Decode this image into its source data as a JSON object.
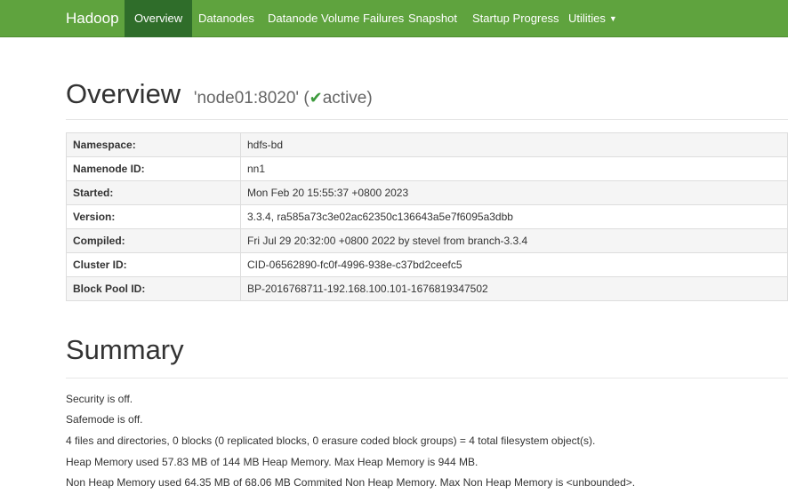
{
  "navbar": {
    "brand": "Hadoop",
    "items": [
      {
        "label": "Overview"
      },
      {
        "label": "Datanodes"
      },
      {
        "label": "Datanode Volume Failures"
      },
      {
        "label": "Snapshot"
      },
      {
        "label": "Startup Progress"
      },
      {
        "label": "Utilities"
      }
    ],
    "active_item": "Overview",
    "active_color": "#2f6d2a",
    "bar_color": "#5fa33e"
  },
  "overview": {
    "title": "Overview",
    "node": "'node01:8020'",
    "status_open": "(",
    "status_check_icon": "check-icon",
    "status": "active)",
    "status_color": "#3c9a3c"
  },
  "info_rows": [
    {
      "label": "Namespace:",
      "value": "hdfs-bd"
    },
    {
      "label": "Namenode ID:",
      "value": "nn1"
    },
    {
      "label": "Started:",
      "value": "Mon Feb 20 15:55:37 +0800 2023"
    },
    {
      "label": "Version:",
      "value": "3.3.4, ra585a73c3e02ac62350c136643a5e7f6095a3dbb"
    },
    {
      "label": "Compiled:",
      "value": "Fri Jul 29 20:32:00 +0800 2022 by stevel from branch-3.3.4"
    },
    {
      "label": "Cluster ID:",
      "value": "CID-06562890-fc0f-4996-938e-c37bd2ceefc5"
    },
    {
      "label": "Block Pool ID:",
      "value": "BP-2016768711-192.168.100.101-1676819347502"
    }
  ],
  "summary": {
    "title": "Summary",
    "lines": [
      "Security is off.",
      "Safemode is off.",
      "4 files and directories, 0 blocks (0 replicated blocks, 0 erasure coded block groups) = 4 total filesystem object(s).",
      "Heap Memory used 57.83 MB of 144 MB Heap Memory. Max Heap Memory is 944 MB.",
      "Non Heap Memory used 64.35 MB of 68.06 MB Commited Non Heap Memory. Max Non Heap Memory is <unbounded>."
    ]
  }
}
